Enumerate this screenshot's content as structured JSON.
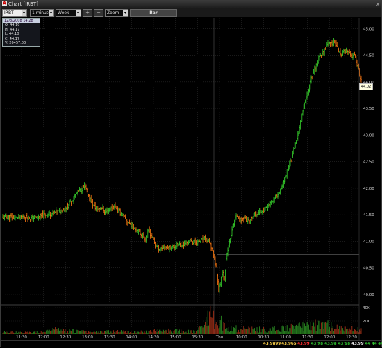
{
  "window": {
    "title": "Chart [IRBT]",
    "close": "x"
  },
  "toolbar": {
    "symbol": "IRBT",
    "interval": "1 minute",
    "range": "Week",
    "plus": "+",
    "minus": "−",
    "zoom": "Zoom",
    "chart_type": "Bar"
  },
  "data_window": {
    "header": "12/3/2008 14:28",
    "rows": [
      "O: 44.10",
      "H: 44.17",
      "L: 44.10",
      "C: 44.17",
      "V: 20457.00"
    ]
  },
  "price_label": "44.02",
  "status": {
    "values": [
      {
        "text": "43.9899",
        "color": "#ffd24a"
      },
      {
        "text": "43.965",
        "color": "#ffd24a"
      },
      {
        "text": "43.99",
        "color": "#ff3030"
      },
      {
        "text": "43.98",
        "color": "#30c030"
      },
      {
        "text": "43.98",
        "color": "#30c030"
      },
      {
        "text": "43.98",
        "color": "#30c030"
      },
      {
        "text": "43.99",
        "color": "#ffffff"
      },
      {
        "text": "44",
        "color": "#30c030"
      },
      {
        "text": "44",
        "color": "#30c030"
      },
      {
        "text": "44",
        "color": "#30c030"
      }
    ]
  },
  "chart_data": {
    "type": "bar",
    "symbol": "IRBT",
    "price_axis": {
      "ticks": [
        "45.00",
        "44.50",
        "44.00",
        "43.50",
        "43.00",
        "42.50",
        "42.00",
        "41.50",
        "41.00",
        "40.50",
        "40.00"
      ],
      "ylim": [
        39.83,
        45.2
      ]
    },
    "volume_axis": {
      "ticks": [
        "40K",
        "20K"
      ]
    },
    "x_tick_labels": [
      "11:30",
      "12:00",
      "12:30",
      "13:00",
      "13:30",
      "14:00",
      "14:30",
      "15:00",
      "15:30",
      "Thu",
      "10:00",
      "10:30",
      "11:00",
      "11:30",
      "12:00",
      "12:30"
    ],
    "price_path": [
      [
        0,
        41.45
      ],
      [
        10,
        41.46
      ],
      [
        20,
        41.44
      ],
      [
        30,
        41.47
      ],
      [
        40,
        41.43
      ],
      [
        50,
        41.45
      ],
      [
        60,
        41.5
      ],
      [
        70,
        41.52
      ],
      [
        80,
        41.56
      ],
      [
        90,
        41.62
      ],
      [
        100,
        41.78
      ],
      [
        106,
        41.9
      ],
      [
        112,
        41.97
      ],
      [
        118,
        42.03
      ],
      [
        124,
        41.85
      ],
      [
        130,
        41.68
      ],
      [
        136,
        41.6
      ],
      [
        142,
        41.64
      ],
      [
        148,
        41.55
      ],
      [
        154,
        41.6
      ],
      [
        160,
        41.68
      ],
      [
        166,
        41.6
      ],
      [
        172,
        41.5
      ],
      [
        178,
        41.38
      ],
      [
        184,
        41.33
      ],
      [
        190,
        41.25
      ],
      [
        196,
        41.18
      ],
      [
        200,
        41.12
      ],
      [
        205,
        41.05
      ],
      [
        210,
        41.2
      ],
      [
        215,
        41.08
      ],
      [
        220,
        40.92
      ],
      [
        226,
        40.86
      ],
      [
        232,
        40.9
      ],
      [
        240,
        40.88
      ],
      [
        250,
        40.92
      ],
      [
        260,
        40.95
      ],
      [
        270,
        41.0
      ],
      [
        280,
        40.98
      ],
      [
        290,
        41.05
      ],
      [
        296,
        41.0
      ],
      [
        302,
        40.84
      ],
      [
        306,
        40.6
      ],
      [
        309,
        40.35
      ],
      [
        311,
        40.05
      ],
      [
        313,
        40.2
      ],
      [
        316,
        40.45
      ],
      [
        319,
        40.3
      ],
      [
        322,
        40.7
      ],
      [
        326,
        40.95
      ],
      [
        330,
        41.2
      ],
      [
        334,
        41.42
      ],
      [
        338,
        41.5
      ],
      [
        342,
        41.4
      ],
      [
        348,
        41.45
      ],
      [
        355,
        41.35
      ],
      [
        362,
        41.5
      ],
      [
        370,
        41.55
      ],
      [
        378,
        41.6
      ],
      [
        385,
        41.72
      ],
      [
        392,
        41.8
      ],
      [
        398,
        41.95
      ],
      [
        404,
        42.1
      ],
      [
        410,
        42.35
      ],
      [
        416,
        42.6
      ],
      [
        422,
        42.85
      ],
      [
        428,
        43.2
      ],
      [
        434,
        43.55
      ],
      [
        440,
        43.85
      ],
      [
        446,
        44.15
      ],
      [
        452,
        44.35
      ],
      [
        458,
        44.5
      ],
      [
        464,
        44.62
      ],
      [
        468,
        44.75
      ],
      [
        472,
        44.68
      ],
      [
        477,
        44.8
      ],
      [
        482,
        44.6
      ],
      [
        487,
        44.5
      ],
      [
        492,
        44.58
      ],
      [
        497,
        44.55
      ],
      [
        502,
        44.5
      ],
      [
        507,
        44.48
      ],
      [
        511,
        44.3
      ],
      [
        515,
        44.05
      ],
      [
        517,
        44.02
      ]
    ],
    "yesterday_close_line": 40.75,
    "volume_profile": [
      [
        0,
        3
      ],
      [
        40,
        2
      ],
      [
        80,
        6
      ],
      [
        120,
        3
      ],
      [
        160,
        4
      ],
      [
        200,
        3
      ],
      [
        240,
        5
      ],
      [
        280,
        3
      ],
      [
        300,
        30
      ],
      [
        306,
        12
      ],
      [
        312,
        18
      ],
      [
        320,
        8
      ],
      [
        360,
        6
      ],
      [
        400,
        7
      ],
      [
        430,
        10
      ],
      [
        460,
        14
      ],
      [
        480,
        8
      ],
      [
        510,
        6
      ]
    ]
  },
  "colors": {
    "up": "#36d12c",
    "down": "#ff7a12",
    "grid": "#2a2a2a",
    "axis_text": "#d8d8d8",
    "volume": "#a03018"
  }
}
